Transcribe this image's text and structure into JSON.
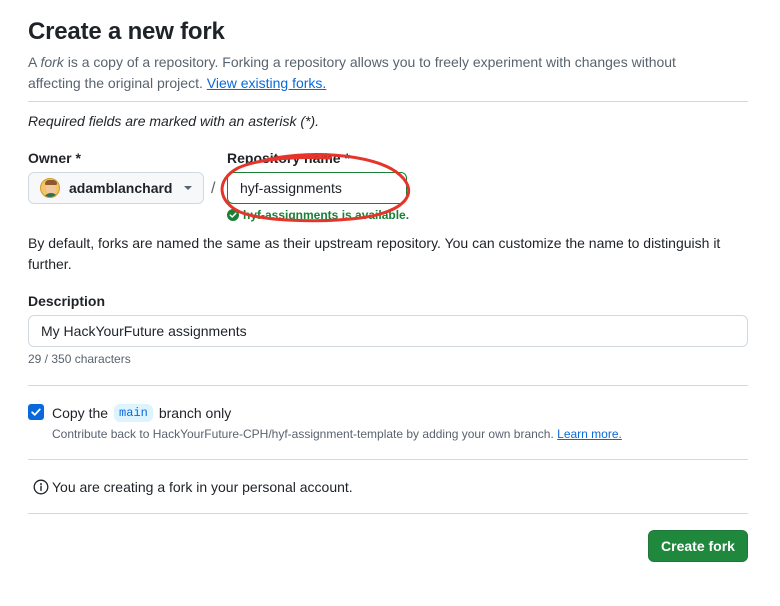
{
  "header": {
    "title": "Create a new fork",
    "subtitle_prefix": "A ",
    "subtitle_em": "fork",
    "subtitle_rest": " is a copy of a repository. Forking a repository allows you to freely experiment with changes without affecting the original project.",
    "view_forks_link": "View existing forks."
  },
  "form": {
    "required_note": "Required fields are marked with an asterisk (*).",
    "owner": {
      "label": "Owner *",
      "value": "adamblanchard"
    },
    "repo_name": {
      "label": "Repository name *",
      "value": "hyf-assignments",
      "availability": "hyf-assignments is available."
    },
    "separator": "/",
    "naming_help": "By default, forks are named the same as their upstream repository. You can customize the name to distinguish it further.",
    "description": {
      "label": "Description",
      "value": "My HackYourFuture assignments",
      "char_count": "29 / 350 characters"
    },
    "copy_branch": {
      "checked": true,
      "label_prefix": "Copy the",
      "branch": "main",
      "label_suffix": "branch only",
      "help": "Contribute back to HackYourFuture-CPH/hyf-assignment-template by adding your own branch.",
      "learn_more": "Learn more."
    },
    "account_info": "You are creating a fork in your personal account.",
    "submit_label": "Create fork"
  },
  "colors": {
    "primary_button": "#1f883d",
    "link": "#0969da",
    "success": "#1a7f37",
    "annotation_circle": "#e5342a"
  }
}
